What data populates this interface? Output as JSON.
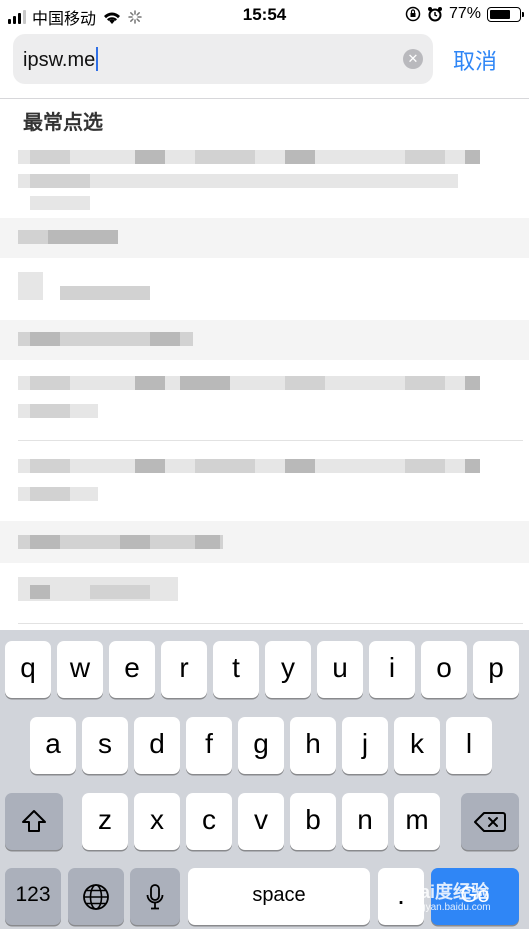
{
  "status_bar": {
    "carrier": "中国移动",
    "time": "15:54",
    "battery_percent": "77%",
    "battery_level": 0.77
  },
  "search": {
    "query": "ipsw.me",
    "cancel_label": "取消"
  },
  "suggestions": {
    "section_title": "最常点选"
  },
  "keyboard": {
    "row1": [
      "q",
      "w",
      "e",
      "r",
      "t",
      "y",
      "u",
      "i",
      "o",
      "p"
    ],
    "row2": [
      "a",
      "s",
      "d",
      "f",
      "g",
      "h",
      "j",
      "k",
      "l"
    ],
    "row3": [
      "z",
      "x",
      "c",
      "v",
      "b",
      "n",
      "m"
    ],
    "numbers_label": "123",
    "space_label": "space",
    "period_label": ".",
    "go_label": "Go"
  },
  "watermark": {
    "brand": "Bai度经验",
    "url": "jingyan.baidu.com"
  },
  "colors": {
    "accent": "#2f86f6",
    "keyboard_bg": "#d1d4da",
    "function_key": "#abb0bb"
  }
}
